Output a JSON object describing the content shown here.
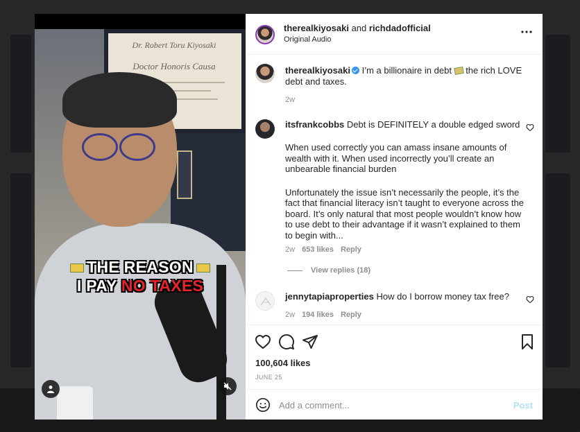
{
  "header": {
    "author": "therealkiyosaki",
    "joiner": "and",
    "collaborator": "richdadofficial",
    "audio": "Original Audio"
  },
  "caption_post": {
    "username": "therealkiyosaki",
    "text_before": "I’m a billionaire in debt",
    "text_after": "the rich LOVE debt and taxes.",
    "time": "2w"
  },
  "comments": [
    {
      "username": "itsfrankcobbs",
      "text_line1": "Debt is DEFINITELY a double edged sword",
      "separator": "⠀⠀⠀⠀⠀⠀⠀⠀⠀⠀⠀⠀⠀⠀",
      "paragraph1": "When used correctly you can amass insane amounts of wealth with it. When used incorrectly you’ll create an unbearable financial burden",
      "paragraph2": "Unfortunately the issue isn’t necessarily the people, it’s the fact that financial literacy isn’t taught to everyone across the board. It’s only natural that most people wouldn’t know how to use debt to their advantage if it wasn’t explained to them to begin with...",
      "time": "2w",
      "likes": "653 likes",
      "reply": "Reply",
      "view_replies": "View replies (18)"
    },
    {
      "username": "jennytapiaproperties",
      "text": "How do I borrow money tax free?",
      "time": "2w",
      "likes": "194 likes",
      "reply": "Reply"
    }
  ],
  "actions": {
    "likes": "100,604 likes",
    "date": "June 25"
  },
  "comment_box": {
    "placeholder": "Add a comment...",
    "post_label": "Post"
  },
  "video": {
    "diploma_name": "Dr. Robert Toru Kiyosaki",
    "diploma_title": "Doctor Honoris Causa",
    "caption_line1": "THE REASON",
    "caption_line2_a": "I PAY",
    "caption_line2_b": "NO TAXES"
  },
  "colors": {
    "verified": "#3897f0",
    "post_disabled": "#b2dffc",
    "caption_red": "#e8232a"
  }
}
